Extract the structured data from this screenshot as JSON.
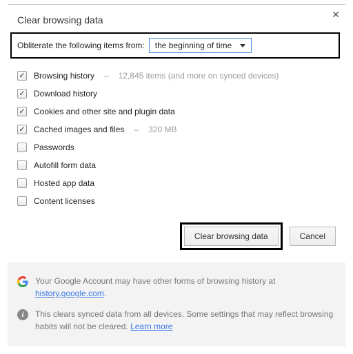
{
  "title": "Clear browsing data",
  "close": "✕",
  "time_row": {
    "label": "Obliterate the following items from:",
    "selected": "the beginning of time"
  },
  "options": [
    {
      "label": "Browsing history",
      "checked": true,
      "meta_count": "12,845 items",
      "meta_extra": "(and more on synced devices)"
    },
    {
      "label": "Download history",
      "checked": true
    },
    {
      "label": "Cookies and other site and plugin data",
      "checked": true
    },
    {
      "label": "Cached images and files",
      "checked": true,
      "meta_count": "320 MB"
    },
    {
      "label": "Passwords",
      "checked": false
    },
    {
      "label": "Autofill form data",
      "checked": false
    },
    {
      "label": "Hosted app data",
      "checked": false
    },
    {
      "label": "Content licenses",
      "checked": false
    }
  ],
  "buttons": {
    "clear": "Clear browsing data",
    "cancel": "Cancel"
  },
  "footer": {
    "account_pre": "Your Google Account may have other forms of browsing history at ",
    "account_link": "history.google.com",
    "account_post": ".",
    "sync_pre": "This clears synced data from all devices. Some settings that may reflect browsing habits will not be cleared. ",
    "sync_link": "Learn more"
  },
  "icons": {
    "info": "i"
  }
}
